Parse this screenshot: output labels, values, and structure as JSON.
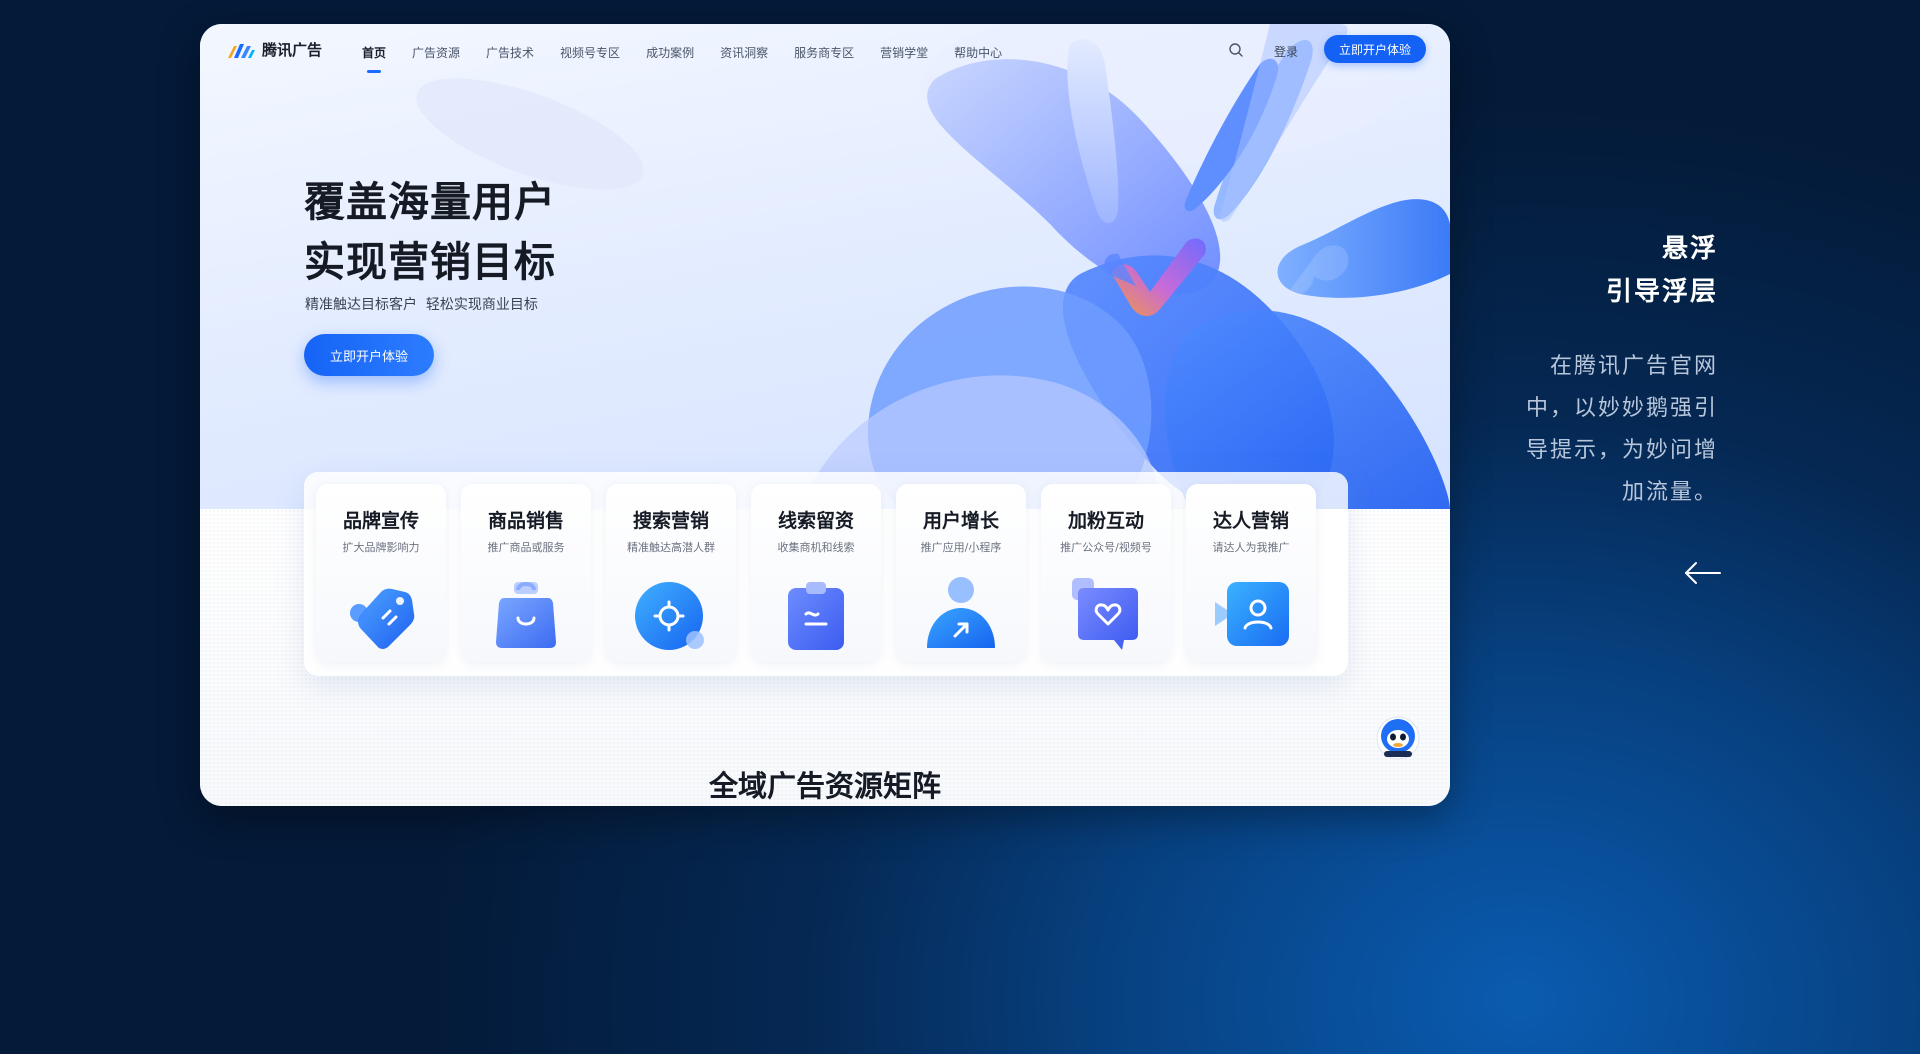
{
  "nav": {
    "brand": "腾讯广告",
    "items": [
      {
        "label": "首页",
        "active": true
      },
      {
        "label": "广告资源"
      },
      {
        "label": "广告技术"
      },
      {
        "label": "视频号专区"
      },
      {
        "label": "成功案例"
      },
      {
        "label": "资讯洞察"
      },
      {
        "label": "服务商专区"
      },
      {
        "label": "营销学堂"
      },
      {
        "label": "帮助中心"
      }
    ],
    "search_icon": "search-icon",
    "login": "登录",
    "cta": "立即开户体验"
  },
  "hero": {
    "title_line1": "覆盖海量用户",
    "title_line2": "实现营销目标",
    "subtitle": "精准触达目标客户  轻松实现商业目标",
    "cta": "立即开户体验"
  },
  "features": [
    {
      "title": "品牌宣传",
      "desc": "扩大品牌影响力",
      "icon": "tag-icon"
    },
    {
      "title": "商品销售",
      "desc": "推广商品或服务",
      "icon": "shopping-bag-icon"
    },
    {
      "title": "搜索营销",
      "desc": "精准触达高潜人群",
      "icon": "target-search-icon"
    },
    {
      "title": "线索留资",
      "desc": "收集商机和线索",
      "icon": "clipboard-icon"
    },
    {
      "title": "用户增长",
      "desc": "推广应用/小程序",
      "icon": "user-growth-icon"
    },
    {
      "title": "加粉互动",
      "desc": "推广公众号/视频号",
      "icon": "heart-chat-icon"
    },
    {
      "title": "达人营销",
      "desc": "请达人为我推广",
      "icon": "creator-icon"
    }
  ],
  "section_title": "全域广告资源矩阵",
  "annotation": {
    "title_line1": "悬浮",
    "title_line2": "引导浮层",
    "body_lines": [
      "在腾讯广告官网",
      "中，以妙妙鹅强引",
      "导提示，为妙问增",
      "加流量。"
    ]
  },
  "colors": {
    "accent": "#1462F5",
    "page_bg": "#052853"
  }
}
